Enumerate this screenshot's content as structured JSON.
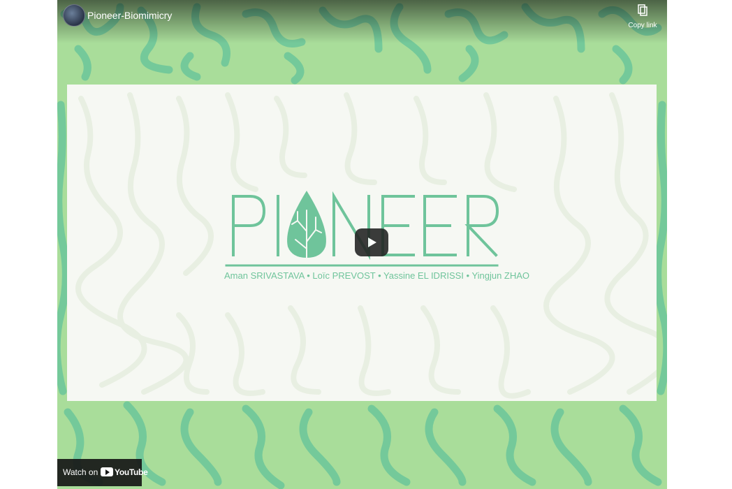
{
  "video": {
    "title": "Pioneer-Biomimicry",
    "copy_link_label": "Copy link",
    "watch_on_label": "Watch on",
    "youtube_label": "YouTube"
  },
  "slide": {
    "logo_text": "PIONEER",
    "authors": "Aman SRIVASTAVA • Loïc PREVOST • Yassine EL IDRISSI • Yingjun ZHAO"
  },
  "icons": {
    "copy": "copy-icon",
    "play": "play-icon",
    "avatar": "channel-avatar",
    "youtube": "youtube-logo-icon"
  },
  "colors": {
    "background_green": "#a9dd9a",
    "pattern_green": "#74c99a",
    "logo_green": "#6fc49b",
    "slide_bg": "#f6f8f3"
  }
}
